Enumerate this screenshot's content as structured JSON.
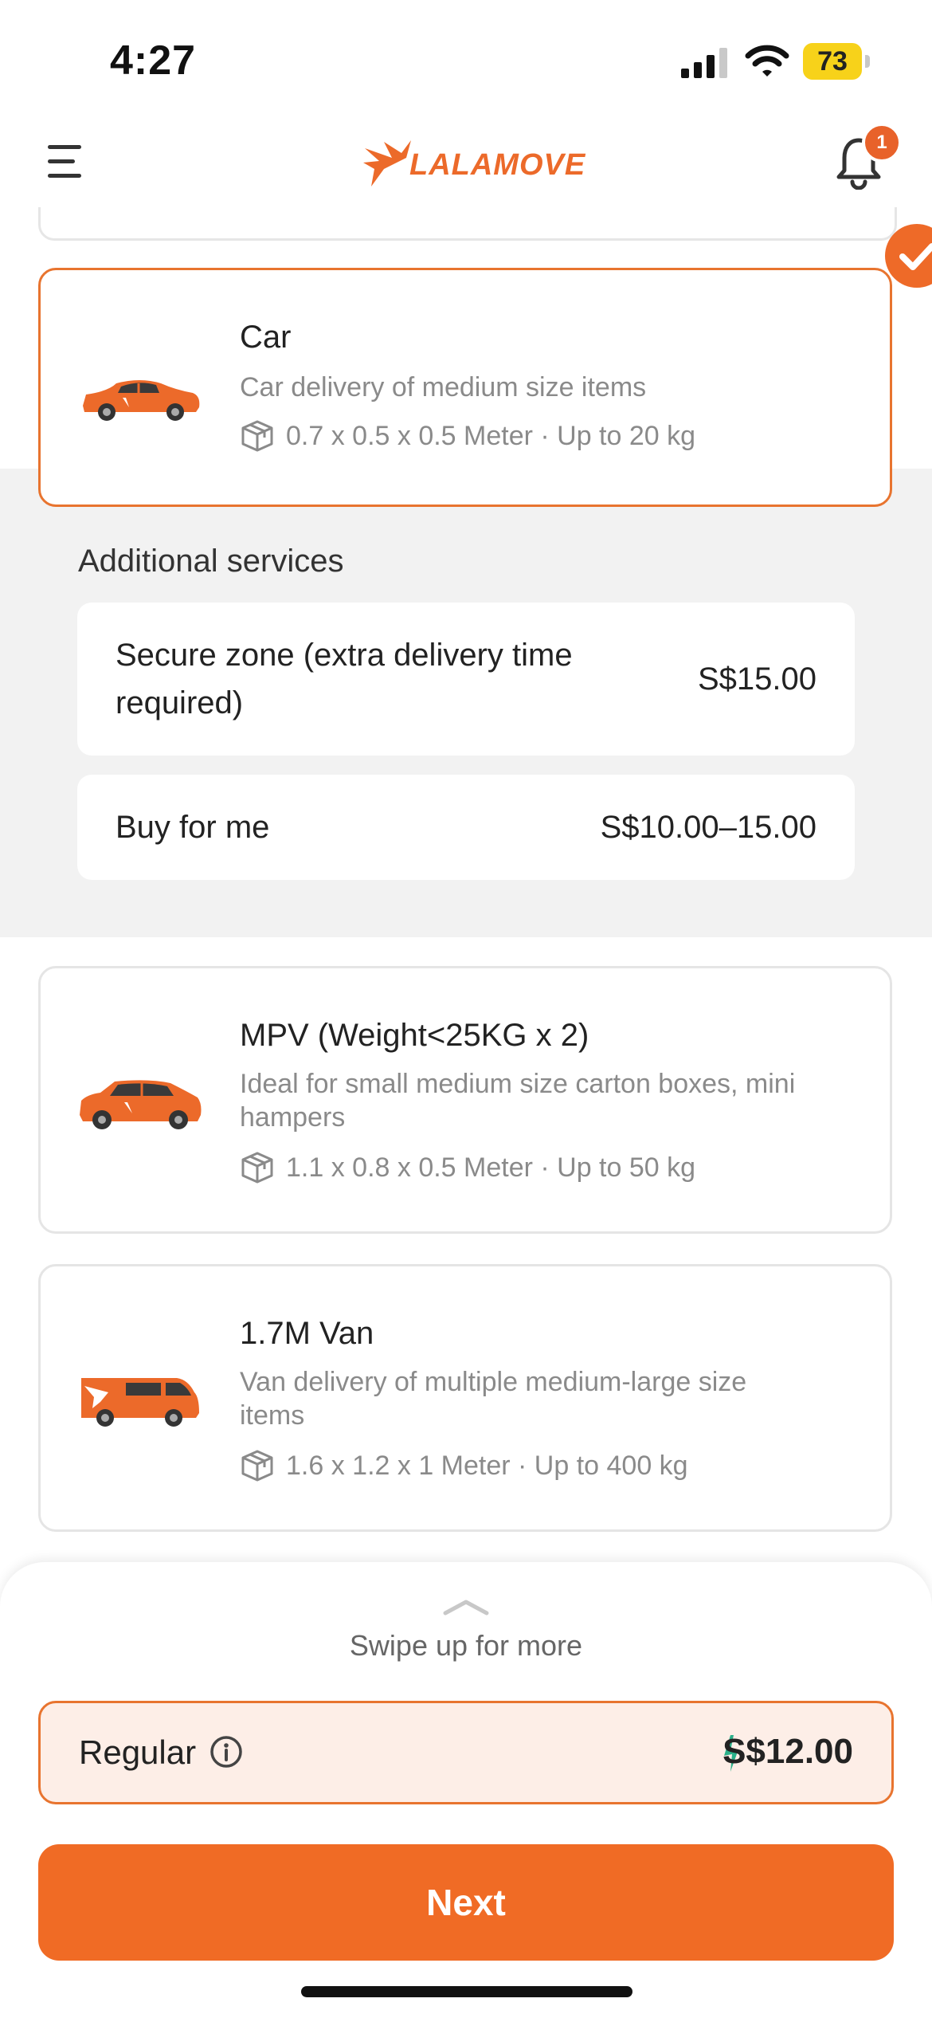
{
  "status_bar": {
    "time": "4:27",
    "battery": "73"
  },
  "header": {
    "logo_text": "LALAMOVE",
    "notification_count": "1"
  },
  "vehicles": [
    {
      "title": "Car",
      "description": "Car delivery of medium size items",
      "spec": "0.7 x 0.5 x 0.5 Meter · Up to 20 kg",
      "selected": true
    },
    {
      "title": "MPV (Weight<25KG x 2)",
      "description": "Ideal for small medium size carton boxes, mini hampers",
      "spec": "1.1 x 0.8 x 0.5 Meter · Up to 50 kg",
      "selected": false
    },
    {
      "title": "1.7M Van",
      "description": "Van delivery of multiple medium-large size items",
      "spec": "1.6 x 1.2 x 1 Meter · Up to 400 kg",
      "selected": false
    }
  ],
  "additional_services": {
    "title": "Additional services",
    "items": [
      {
        "label": "Secure zone (extra delivery time required)",
        "price": "S$15.00"
      },
      {
        "label": "Buy for me",
        "price": "S$10.00–15.00"
      }
    ]
  },
  "bottom_sheet": {
    "swipe_hint": "Swipe up for more",
    "option_label": "Regular",
    "price": "S$12.00",
    "next_label": "Next"
  },
  "colors": {
    "accent": "#f06b25",
    "badge": "#e8622a",
    "selected_border": "#e8742f",
    "bolt": "#2bb08a"
  }
}
